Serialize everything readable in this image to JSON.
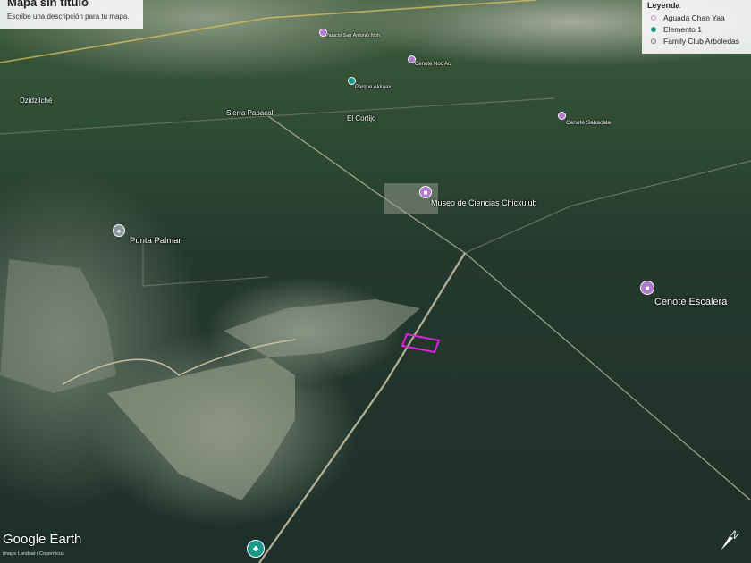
{
  "header": {
    "title": "Mapa sin título",
    "description": "Escribe una descripción para tu mapa."
  },
  "legend": {
    "title": "Leyenda",
    "items": [
      {
        "label": "Aguada Chan Yaa",
        "color": "#c98ee0"
      },
      {
        "label": "Elemento 1",
        "color": "#1a9a86"
      },
      {
        "label": "Family Club Arboledas",
        "color": "#777788"
      }
    ]
  },
  "places": {
    "palacio": "Palacio San Antonio Noh",
    "cenote_noc_ac": "Cenote Noc Ac",
    "parque": "Parque Akkaax",
    "dzidzilche": "Dzidzilché",
    "sierra": "Sierra Papacal",
    "cortijo": "El Cortijo",
    "sabacala": "Cenote Sabacala",
    "museo": "Museo de Ciencias Chicxulub",
    "punta_palmar": "Punta Palmar",
    "escalera": "Cenote Escalera"
  },
  "colors": {
    "poi_purple": "#b07ad0",
    "poi_teal": "#1a9a86",
    "polygon": "#e020e0"
  },
  "footer": {
    "logo": "Google Earth",
    "credit": "Image Landsat / Copernicus"
  },
  "compass_icon": "north-arrow-icon"
}
